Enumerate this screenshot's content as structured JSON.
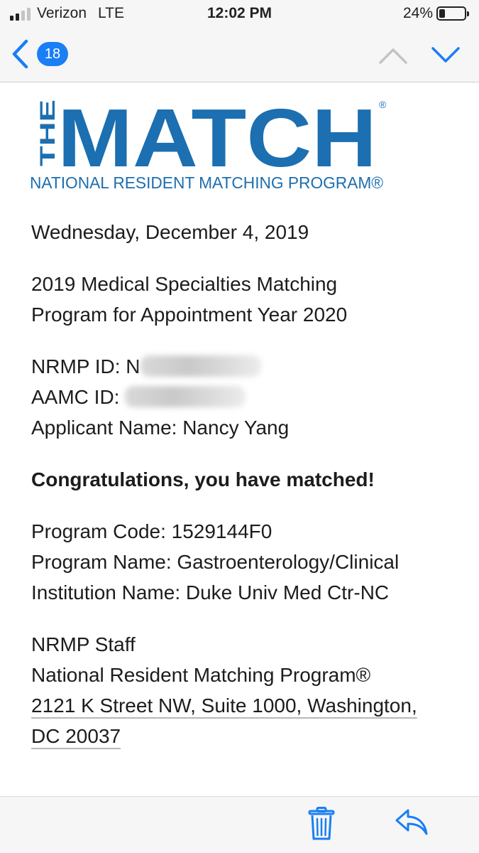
{
  "status_bar": {
    "carrier": "Verizon",
    "network": "LTE",
    "time": "12:02 PM",
    "battery_percent": "24%",
    "battery_level": 0.24,
    "signal_bars_active": 2,
    "signal_bars_total": 4
  },
  "nav": {
    "back_badge": "18",
    "back_icon": "chevron-left-icon",
    "up_icon": "chevron-up-icon",
    "down_icon": "chevron-down-icon",
    "accent_color": "#1a7ef5"
  },
  "logo": {
    "the": "THE",
    "match": "MATCH",
    "registered": "®",
    "tagline": "NATIONAL RESIDENT MATCHING PROGRAM®",
    "color": "#1c6fb0"
  },
  "email": {
    "date": "Wednesday, December 4, 2019",
    "program_line1": "2019 Medical Specialties Matching",
    "program_line2": "Program for Appointment Year 2020",
    "nrmp_id_label": "NRMP ID: N",
    "aamc_id_label": "AAMC ID: ",
    "applicant": "Applicant Name: Nancy Yang",
    "congrats": "Congratulations, you have matched!",
    "program_code": "Program Code: 1529144F0",
    "program_name": "Program Name: Gastroenterology/Clinical",
    "institution": "Institution Name: Duke Univ Med Ctr-NC",
    "sender": "NRMP Staff",
    "org": "National Resident Matching Program®",
    "address_line1": "2121 K Street NW, Suite 1000, Washington,",
    "address_line2": "DC 20037"
  },
  "toolbar": {
    "trash_icon": "trash-icon",
    "reply_icon": "reply-icon"
  }
}
